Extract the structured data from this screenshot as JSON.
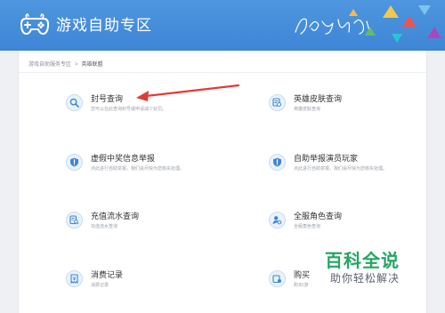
{
  "header": {
    "title": "游戏自助专区",
    "slogan": "用心的游戏"
  },
  "breadcrumb": {
    "root": "游戏自助服务专区",
    "separator": ">",
    "current": "英雄联盟"
  },
  "services": [
    {
      "name": "封号查询",
      "desc": "您可以在此查询封号或申请减少处罚。",
      "icon": "search-icon"
    },
    {
      "name": "英雄皮肤查询",
      "desc": "英雄皮肤查询",
      "icon": "hero-skin-icon"
    },
    {
      "name": "虚假中奖信息举报",
      "desc": "点此进行自助举报，我们会尽快为您核实处理。",
      "icon": "shield-alert-icon"
    },
    {
      "name": "自助举报演员玩家",
      "desc": "点此进行自助举报，我们会尽快为您核实处理。",
      "icon": "shield-alert-icon"
    },
    {
      "name": "充值流水查询",
      "desc": "充值流水查询",
      "icon": "recharge-search-icon"
    },
    {
      "name": "全服角色查询",
      "desc": "全服角色查询",
      "icon": "user-search-icon"
    },
    {
      "name": "消费记录",
      "desc": "消费记录",
      "icon": "wallet-icon"
    },
    {
      "name": "购买",
      "desc": "购买/游",
      "icon": "purchase-icon"
    }
  ],
  "watermark": {
    "brand": "百科全说",
    "tagline": "助你轻松解决"
  },
  "colors": {
    "header": "#4a90dd",
    "accent": "#3d85d6",
    "annotation_arrow": "#e53935",
    "watermark": "#24a564"
  }
}
